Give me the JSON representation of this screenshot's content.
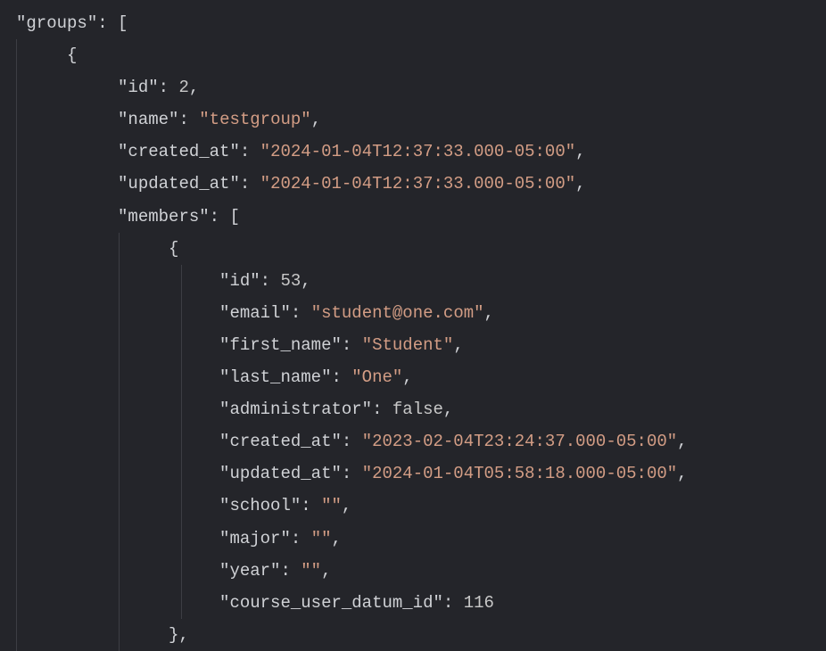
{
  "keys": {
    "groups": "\"groups\"",
    "id": "\"id\"",
    "name": "\"name\"",
    "created_at": "\"created_at\"",
    "updated_at": "\"updated_at\"",
    "members": "\"members\"",
    "email": "\"email\"",
    "first_name": "\"first_name\"",
    "last_name": "\"last_name\"",
    "administrator": "\"administrator\"",
    "school": "\"school\"",
    "major": "\"major\"",
    "year": "\"year\"",
    "course_user_datum_id": "\"course_user_datum_id\""
  },
  "values": {
    "group_id": "2",
    "group_name": "\"testgroup\"",
    "group_created_at": "\"2024-01-04T12:37:33.000-05:00\"",
    "group_updated_at": "\"2024-01-04T12:37:33.000-05:00\"",
    "member_id": "53",
    "member_email": "\"student@one.com\"",
    "member_first_name": "\"Student\"",
    "member_last_name": "\"One\"",
    "member_administrator": "false",
    "member_created_at": "\"2023-02-04T23:24:37.000-05:00\"",
    "member_updated_at": "\"2024-01-04T05:58:18.000-05:00\"",
    "member_school": "\"\"",
    "member_major": "\"\"",
    "member_year": "\"\"",
    "member_course_user_datum_id": "116"
  },
  "punct": {
    "colon_space": ": ",
    "comma": ",",
    "open_bracket": "[",
    "close_bracket": "]",
    "open_brace": "{",
    "close_brace": "}",
    "close_brace_comma": "},"
  }
}
